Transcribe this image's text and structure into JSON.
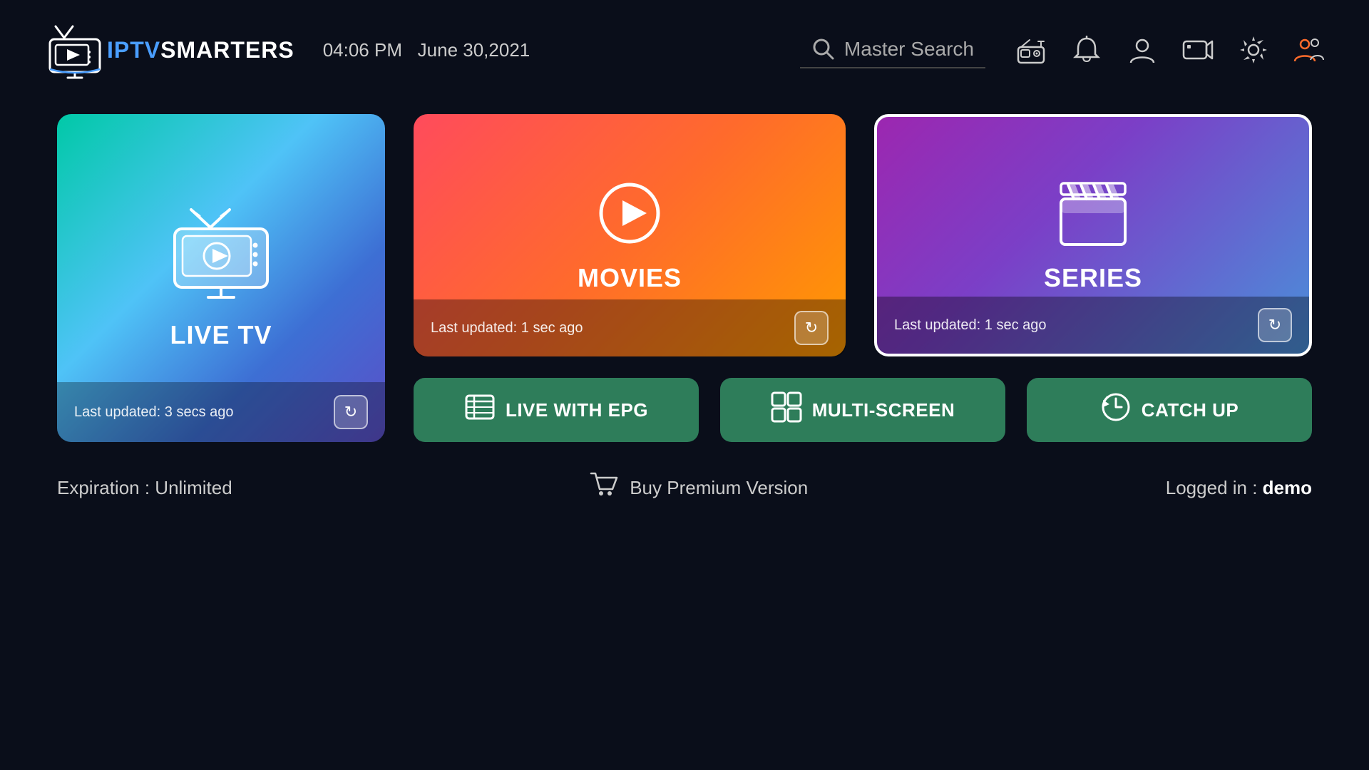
{
  "header": {
    "logo_iptv": "IPTV",
    "logo_smarters": "SMARTERS",
    "time": "04:06 PM",
    "date": "June 30,2021",
    "search_placeholder": "Master Search",
    "icons": {
      "radio": "📻",
      "bell": "🔔",
      "user": "👤",
      "record": "📹",
      "settings": "⚙️",
      "multiuser": "👥"
    }
  },
  "cards": {
    "live_tv": {
      "label": "LIVE TV",
      "last_updated": "Last updated: 3 secs ago"
    },
    "movies": {
      "label": "MOVIES",
      "last_updated": "Last updated: 1 sec ago"
    },
    "series": {
      "label": "SERIES",
      "last_updated": "Last updated: 1 sec ago"
    }
  },
  "bottom_buttons": {
    "live_epg": "LIVE WITH EPG",
    "multi_screen": "MULTI-SCREEN",
    "catch_up": "CATCH UP"
  },
  "footer": {
    "expiration": "Expiration : Unlimited",
    "buy_label": "Buy Premium Version",
    "logged_in_label": "Logged in : ",
    "logged_in_user": "demo"
  },
  "refresh_symbol": "↻"
}
